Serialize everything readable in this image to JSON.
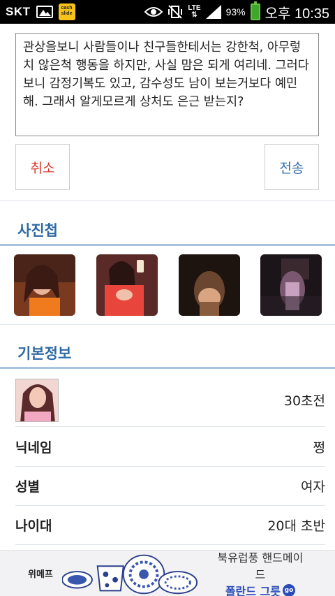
{
  "status_bar": {
    "carrier": "SKT",
    "cash_slide_icon_text": "cash slide",
    "network": "LTE",
    "battery_percent": "93%",
    "time": "오후 10:35"
  },
  "message": {
    "text": "관상을보니 사람들이나 친구들한테서는 강한척, 아무렇치 않은척 행동을 하지만, 사실 맘은 되게 여리네. 그러다 보니 감정기복도 있고, 감수성도 남이 보는거보다 예민해. 그래서 알게모르게 상처도 은근 받는지?"
  },
  "buttons": {
    "cancel": "취소",
    "send": "전송"
  },
  "photos_section": {
    "title": "사진첩",
    "photos": [
      {
        "name": "photo-1",
        "tone": "#c8642a"
      },
      {
        "name": "photo-2",
        "tone": "#d8483f"
      },
      {
        "name": "photo-3",
        "tone": "#3a2a22"
      },
      {
        "name": "photo-4",
        "tone": "#2a1f22"
      }
    ]
  },
  "basic_info_section": {
    "title": "기본정보",
    "last_seen": "30초전",
    "rows": [
      {
        "label": "닉네임",
        "value": "쩡"
      },
      {
        "label": "성별",
        "value": "여자"
      },
      {
        "label": "나이대",
        "value": "20대 초반"
      }
    ]
  },
  "ad_banner": {
    "brand": "위메프",
    "line1": "북유럽풍 핸드메이드",
    "line2": "폴란드 그릇",
    "badge": "go"
  },
  "colors": {
    "accent_blue": "#2f6aa5",
    "cancel_red": "#d83a2e",
    "section_line": "#a8c3de"
  }
}
